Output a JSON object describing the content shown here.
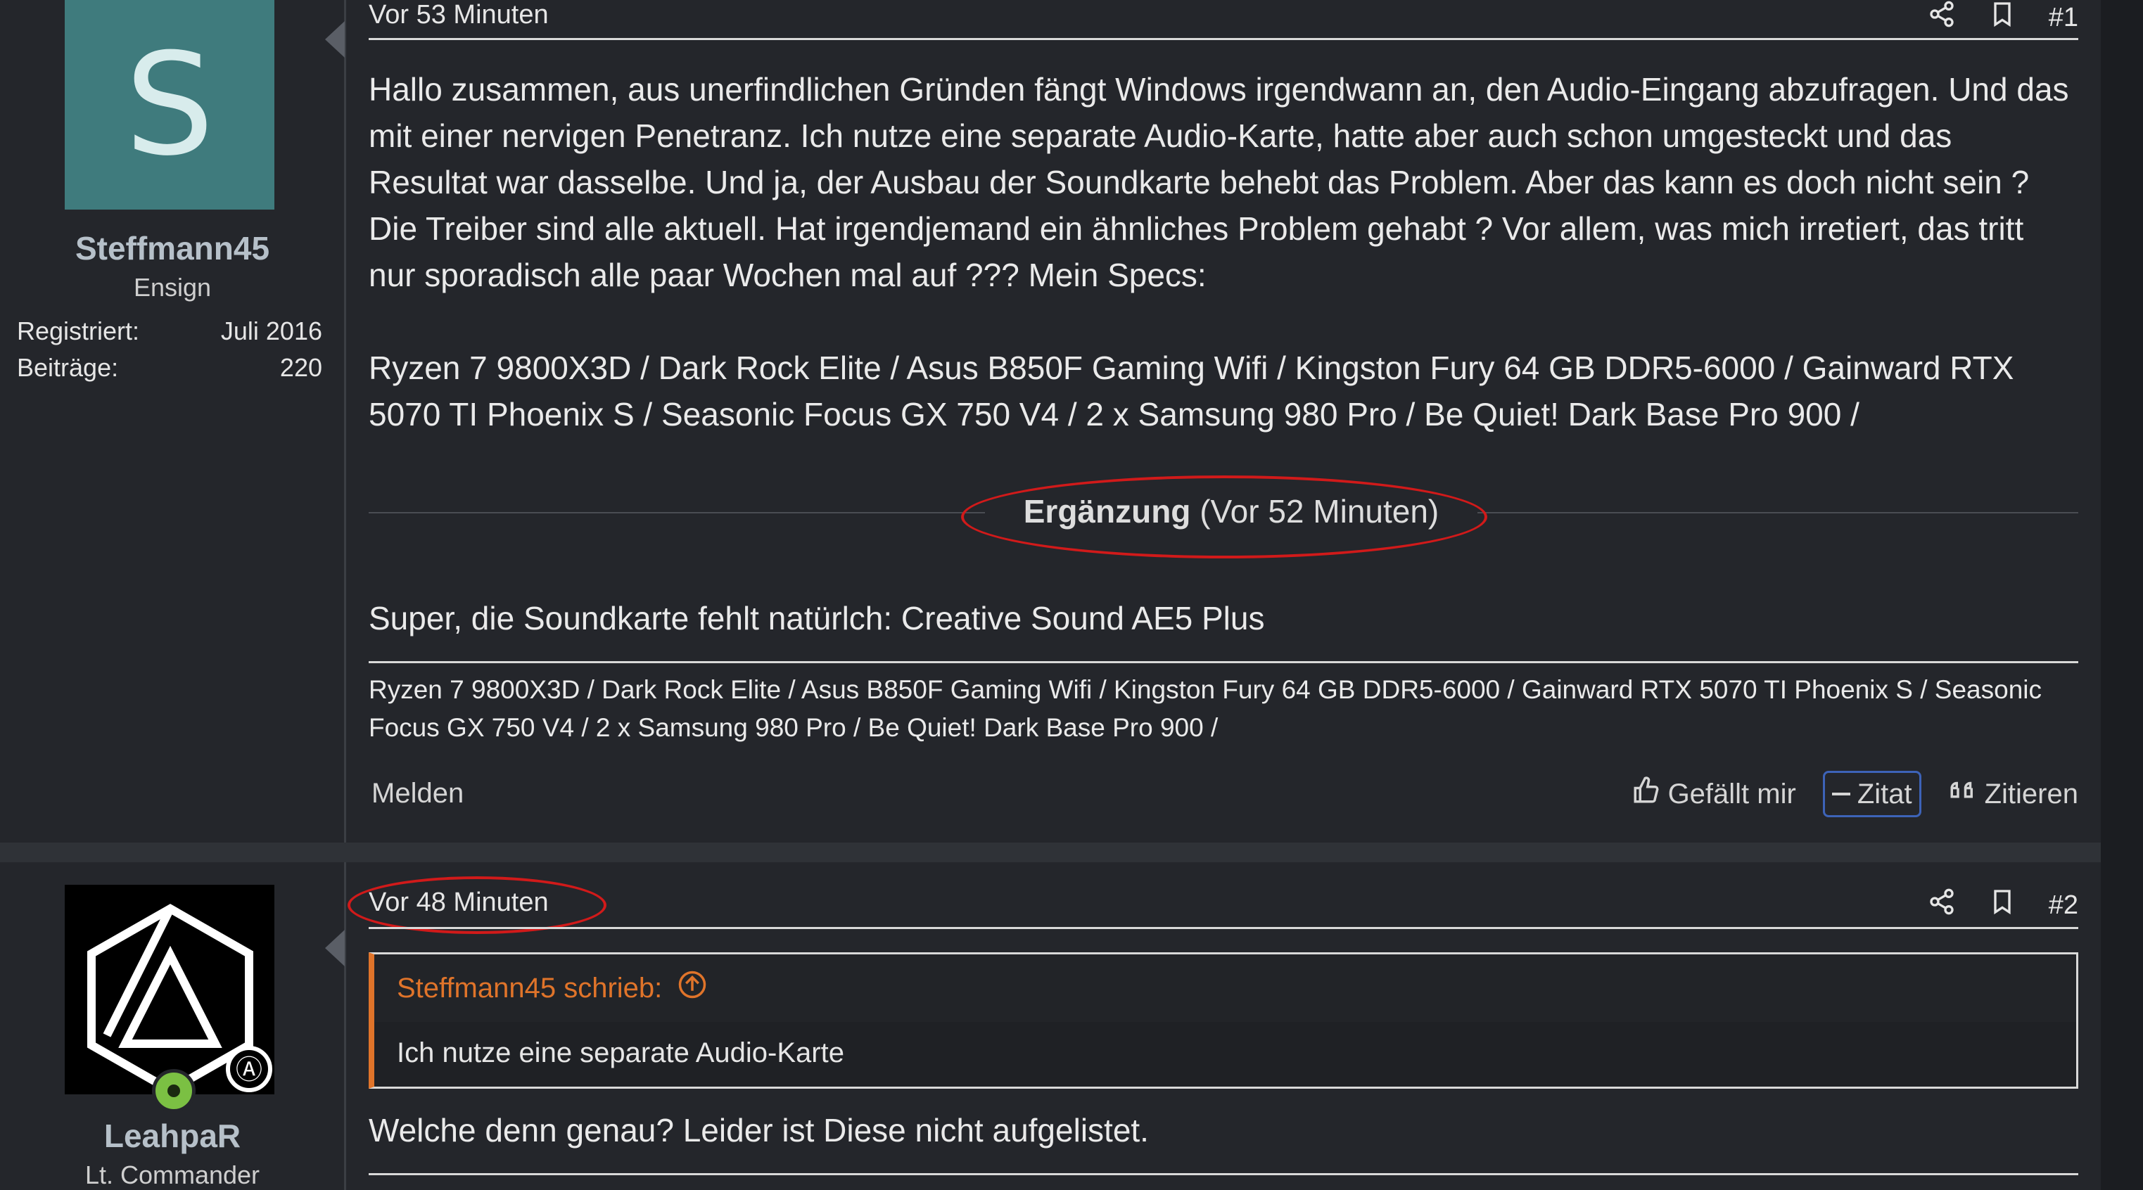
{
  "posts": [
    {
      "user": {
        "avatar_letter": "S",
        "avatar_color": "#3f7b7d",
        "name": "Steffmann45",
        "rank": "Ensign",
        "stats": [
          {
            "label": "Registriert:",
            "value": "Juli 2016"
          },
          {
            "label": "Beiträge:",
            "value": "220"
          }
        ]
      },
      "time": "Vor 53 Minuten",
      "number": "#1",
      "body": [
        "Hallo zusammen, aus unerfindlichen Gründen fängt Windows irgendwann an, den Audio-Eingang abzufragen. Und das mit einer nervigen Penetranz. Ich nutze eine separate Audio-Karte, hatte aber auch schon umgesteckt und das Resultat war dasselbe. Und ja, der Ausbau der Soundkarte behebt das Problem. Aber das kann es doch nicht sein ? Die Treiber sind alle aktuell. Hat irgendjemand ein ähnliches Problem gehabt ? Vor allem, was mich irretiert, das tritt nur sporadisch alle paar Wochen mal auf ??? Mein Specs:",
        "Ryzen 7 9800X3D / Dark Rock Elite / Asus B850F Gaming Wifi / Kingston Fury 64 GB DDR5-6000 / Gainward RTX 5070 TI Phoenix S / Seasonic Focus GX 750 V4 / 2 x Samsung 980 Pro / Be Quiet! Dark Base Pro 900 /"
      ],
      "addition": {
        "label": "Ergänzung",
        "time": "(Vor 52 Minuten)",
        "text": "Super, die Soundkarte fehlt natürlch: Creative Sound AE5 Plus"
      },
      "signature": "Ryzen 7 9800X3D / Dark Rock Elite / Asus B850F Gaming Wifi / Kingston Fury 64 GB DDR5-6000 / Gainward RTX 5070 TI Phoenix S / Seasonic Focus GX 750 V4 / 2 x Samsung 980 Pro / Be Quiet! Dark Base Pro 900 /",
      "footer": {
        "report": "Melden",
        "like": "Gefällt mir",
        "quote_toggle": "Zitat",
        "reply_quote": "Zitieren"
      }
    },
    {
      "user": {
        "name": "LeahpaR",
        "rank": "Lt. Commander",
        "online": true
      },
      "time": "Vor 48 Minuten",
      "number": "#2",
      "quote": {
        "author": "Steffmann45 schrieb:",
        "text": "Ich nutze eine separate Audio-Karte"
      },
      "body": "Welche denn genau? Leider ist Diese nicht aufgelistet."
    }
  ],
  "colors": {
    "accent_quote": "#e0742a",
    "annotation_red": "#d11a1a",
    "button_border": "#3d63b8",
    "background": "#24262b"
  },
  "icons": [
    "share-icon",
    "bookmark-icon",
    "thumbs-up-icon",
    "minus-icon",
    "quote-marks-icon",
    "arrow-up-circle-icon",
    "online-status-icon"
  ]
}
